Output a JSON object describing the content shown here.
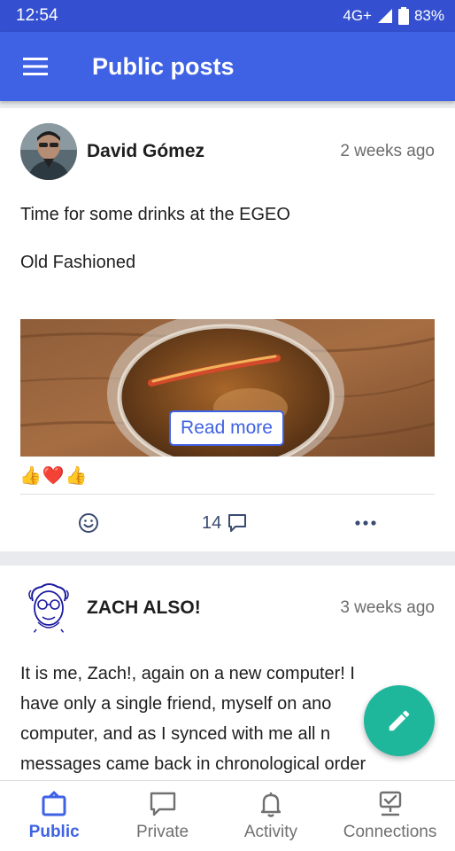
{
  "status_bar": {
    "time": "12:54",
    "network": "4G+",
    "battery": "83%"
  },
  "app_bar": {
    "title": "Public posts",
    "menu_icon": "menu-icon"
  },
  "posts": [
    {
      "author": "David Gómez",
      "time": "2 weeks ago",
      "lines": [
        "Time for some drinks at the EGEO",
        "Old Fashioned"
      ],
      "read_more": "Read more",
      "reactions": [
        "👍",
        "❤️",
        "👍"
      ],
      "comment_count": "14"
    },
    {
      "author": "ZACH ALSO!",
      "time": "3 weeks ago",
      "lines": [
        "It is me, Zach!, again on a new computer! I",
        "have only a single friend, myself on ano",
        "computer, and as I synced with me all n",
        "messages came back in chronological order"
      ]
    }
  ],
  "bottom_nav": [
    {
      "label": "Public",
      "icon": "public-icon",
      "active": true
    },
    {
      "label": "Private",
      "icon": "private-icon",
      "active": false
    },
    {
      "label": "Activity",
      "icon": "bell-icon",
      "active": false
    },
    {
      "label": "Connections",
      "icon": "connections-icon",
      "active": false
    }
  ],
  "colors": {
    "primary": "#3f62e4",
    "status_bar": "#3450d0",
    "fab": "#1fb79c"
  }
}
